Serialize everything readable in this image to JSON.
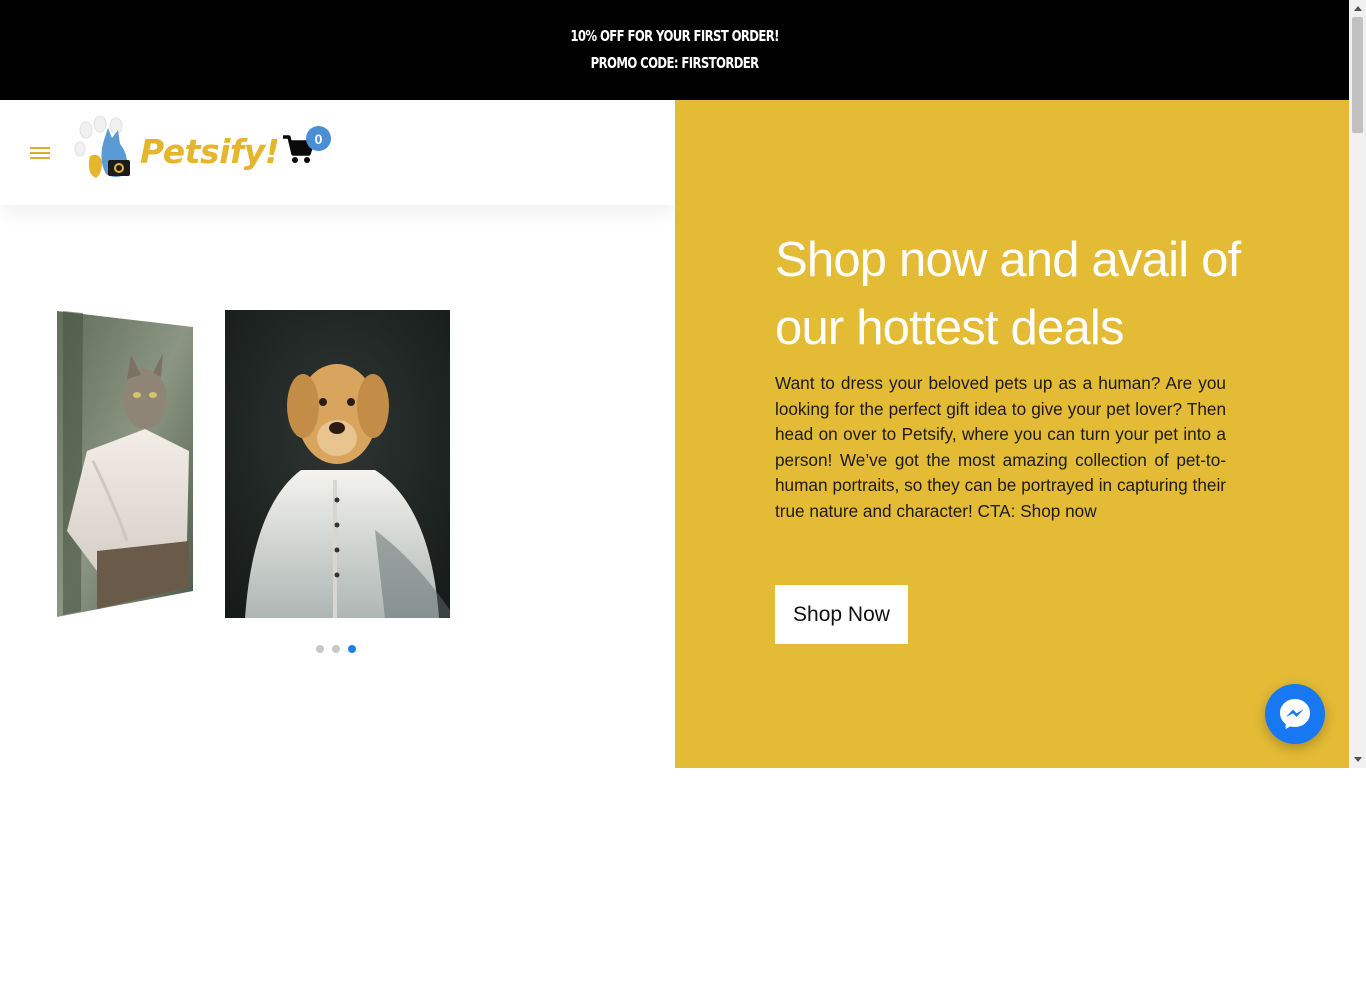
{
  "promo": {
    "line1": "10% OFF FOR YOUR FIRST ORDER!",
    "line2": "PROMO CODE: FIRSTORDER"
  },
  "header": {
    "logo_text": "Petsify!",
    "cart_count": "0",
    "menu_icon": "hamburger-menu-icon",
    "cart_icon": "shopping-cart-icon"
  },
  "carousel": {
    "slides": [
      {
        "subject": "cat portrait"
      },
      {
        "subject": "dog portrait"
      }
    ],
    "dots_total": 3,
    "active_dot": 3
  },
  "hero": {
    "heading": "Shop now and avail of our hottest deals",
    "body": "Want to dress your beloved pets up as a human? Are you looking for the perfect gift idea to give your pet lover? Then head on over to Petsify, where you can turn your pet into a person! We’ve got the most amazing collection of pet-to-human portraits, so they can be portrayed in capturing their true nature and character! CTA: Shop now",
    "button_label": "Shop Now"
  },
  "colors": {
    "promo_bg": "#000000",
    "hero_bg": "#e4bb35",
    "brand_yellow": "#e6b52e",
    "cart_badge": "#4a8fd4",
    "messenger": "#1877f2",
    "dot_active": "#1a82e2"
  }
}
